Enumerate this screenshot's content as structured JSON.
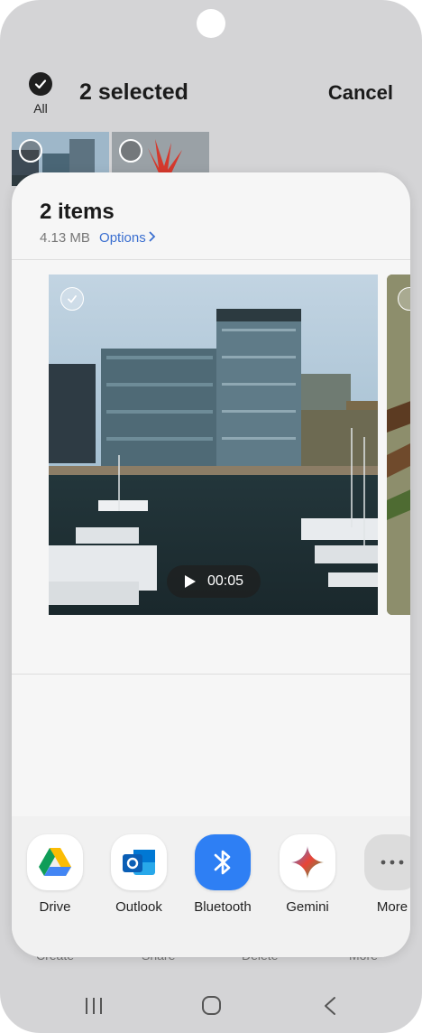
{
  "top_bar": {
    "all_label": "All",
    "selected_title": "2 selected",
    "cancel_label": "Cancel"
  },
  "background_actions": {
    "create": "Create",
    "share": "Share",
    "delete": "Delete",
    "more": "More"
  },
  "share_sheet": {
    "title": "2 items",
    "size": "4.13 MB",
    "options_label": "Options",
    "video_duration": "00:05"
  },
  "apps": [
    {
      "label": "Drive",
      "icon": "google-drive-icon"
    },
    {
      "label": "Outlook",
      "icon": "outlook-icon"
    },
    {
      "label": "Bluetooth",
      "icon": "bluetooth-icon"
    },
    {
      "label": "Gemini",
      "icon": "gemini-icon"
    },
    {
      "label": "More",
      "icon": "more-dots-icon"
    }
  ],
  "colors": {
    "accent": "#3b6fd0",
    "bluetooth": "#2e7ff4",
    "background": "#d4d4d6",
    "sheet": "#f6f6f6"
  }
}
